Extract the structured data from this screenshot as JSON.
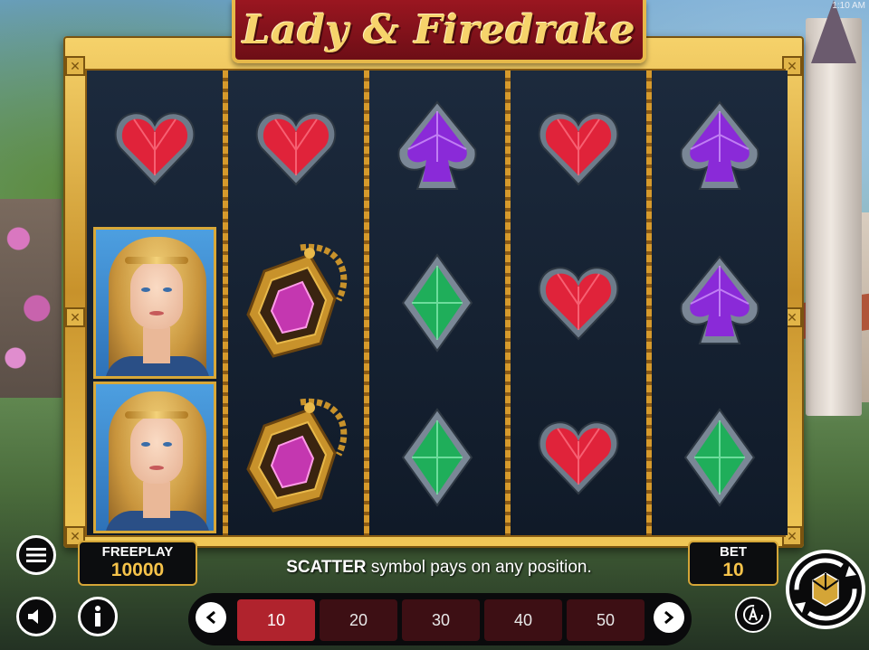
{
  "clock": "1:10 AM",
  "game_title": "Lady & Firedrake",
  "reels": [
    [
      "heart",
      "lady",
      "lady"
    ],
    [
      "heart",
      "amulet",
      "amulet"
    ],
    [
      "spade",
      "emerald",
      "emerald"
    ],
    [
      "heart",
      "heart",
      "heart"
    ],
    [
      "spade",
      "spade",
      "emerald"
    ]
  ],
  "colors": {
    "heart": "#e0233a",
    "spade": "#8a2ad8",
    "emerald": "#1fae5a",
    "gold": "#d4a537",
    "active_bet": "#b0232d"
  },
  "balance": {
    "label": "FREEPLAY",
    "value": "10000"
  },
  "bet": {
    "label": "BET",
    "value": "10"
  },
  "message": {
    "highlight": "SCATTER",
    "rest": "symbol pays on any position."
  },
  "bet_options": [
    "10",
    "20",
    "30",
    "40",
    "50"
  ],
  "selected_bet_index": 0,
  "icons": {
    "menu": "hamburger-icon",
    "sound": "speaker-icon",
    "info": "info-icon",
    "prev": "chevron-left-icon",
    "next": "chevron-right-icon",
    "auto": "autoplay-icon",
    "spin": "spin-icon"
  }
}
